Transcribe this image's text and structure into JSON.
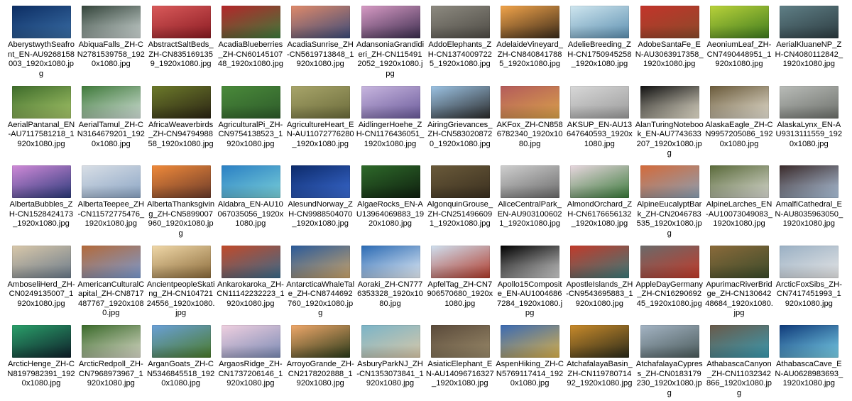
{
  "files": [
    {
      "name": "AberystwythSeafront_EN-AU9268158003_1920x1080.jpg",
      "colors": [
        "#0c2d63",
        "#3a6ea5"
      ]
    },
    {
      "name": "AbiquaFalls_ZH-CN2781539758_1920x1080.jpg",
      "colors": [
        "#33443a",
        "#cfd8d6"
      ]
    },
    {
      "name": "AbstractSaltBeds_ZH-CN8351691359_1920x1080.jpg",
      "colors": [
        "#d95a5a",
        "#8a1b22"
      ]
    },
    {
      "name": "AcadiaBlueberries_ZH-CN6014510748_1920x1080.jpg",
      "colors": [
        "#b5262a",
        "#3d7a3a"
      ]
    },
    {
      "name": "AcadiaSunrise_ZH-CN5619713848_1920x1080.jpg",
      "colors": [
        "#e08a6a",
        "#3b4a78"
      ]
    },
    {
      "name": "AdansoniaGrandidieri_ZH-CN1154912052_1920x1080.jpg",
      "colors": [
        "#d79ac4",
        "#3b2d4e"
      ]
    },
    {
      "name": "AddoElephants_ZH-CN13740097225_1920x1080.jpg",
      "colors": [
        "#8d8a80",
        "#4d4a44"
      ]
    },
    {
      "name": "AdelaideVineyard_ZH-CN8408417885_1920x1080.jpg",
      "colors": [
        "#f2a44a",
        "#3a2a1a"
      ]
    },
    {
      "name": "AdelieBreeding_ZH-CN1750945258_1920x1080.jpg",
      "colors": [
        "#cfe6ef",
        "#5c8fb0"
      ]
    },
    {
      "name": "AdobeSantaFe_EN-AU3063917358_1920x1080.jpg",
      "colors": [
        "#c3342a",
        "#8b4a2a"
      ]
    },
    {
      "name": "AeoniumLeaf_ZH-CN7490448951_1920x1080.jpg",
      "colors": [
        "#b9d23a",
        "#3e7a1e"
      ]
    },
    {
      "name": "AerialKluaneNP_ZH-CN4080112842_1920x1080.jpg",
      "colors": [
        "#5f7f86",
        "#2c3b40"
      ]
    },
    {
      "name": "AerialPantanal_EN-AU7117581218_1920x1080.jpg",
      "colors": [
        "#3d6b2a",
        "#a7c66a"
      ]
    },
    {
      "name": "AerialTamul_ZH-CN3164679201_1920x1080.jpg",
      "colors": [
        "#3f7a3a",
        "#d2e0d9"
      ]
    },
    {
      "name": "AfricaWeaverbirds_ZH-CN9479498858_1920x1080.jpg",
      "colors": [
        "#6c7a2a",
        "#2b2414"
      ]
    },
    {
      "name": "AgriculturalPi_ZH-CN9754138523_1920x1080.jpg",
      "colors": [
        "#4a8a3a",
        "#2d5a2a"
      ]
    },
    {
      "name": "AgricultureHeart_EN-AU11072776280_1920x1080.jpg",
      "colors": [
        "#a8a56a",
        "#6a6a3a"
      ]
    },
    {
      "name": "AidlingerHoehe_ZH-CN1176436051_1920x1080.jpg",
      "colors": [
        "#c8b6df",
        "#6a5a9a"
      ]
    },
    {
      "name": "AiringGrievances_ZH-CN5830208720_1920x1080.jpg",
      "colors": [
        "#9cc3e4",
        "#2a2a2a"
      ]
    },
    {
      "name": "AKFox_ZH-CN8586782340_1920x1080.jpg",
      "colors": [
        "#b45b5b",
        "#d9a24a"
      ]
    },
    {
      "name": "AKSUP_EN-AU13647640593_1920x1080.jpg",
      "colors": [
        "#d8d8d8",
        "#9a9a9a"
      ]
    },
    {
      "name": "AlanTuringNotebook_EN-AU7743633207_1920x1080.jpg",
      "colors": [
        "#111111",
        "#e9e3d0"
      ]
    },
    {
      "name": "AlaskaEagle_ZH-CN9957205086_1920x1080.jpg",
      "colors": [
        "#6a5a3a",
        "#e7e2d4"
      ]
    },
    {
      "name": "AlaskaLynx_EN-AU9313111559_1920x1080.jpg",
      "colors": [
        "#b9bcb8",
        "#6c6f6a"
      ]
    },
    {
      "name": "AlbertaBubbles_ZH-CN1528424173_1920x1080.jpg",
      "colors": [
        "#d08ad8",
        "#2b3a7a"
      ]
    },
    {
      "name": "AlbertaTeepee_ZH-CN11572775476_1920x1080.jpg",
      "colors": [
        "#d9dfe6",
        "#8aa4c4"
      ]
    },
    {
      "name": "AlbertaThanksgiving_ZH-CN5899007960_1920x1080.jpg",
      "colors": [
        "#f08a3a",
        "#6a3a2a"
      ]
    },
    {
      "name": "Aldabra_EN-AU10067035056_1920x1080.jpg",
      "colors": [
        "#2a7fc4",
        "#7ad0d8"
      ]
    },
    {
      "name": "AlesundNorway_ZH-CN9988504070_1920x1080.jpg",
      "colors": [
        "#0c2a6a",
        "#3a6ad0"
      ]
    },
    {
      "name": "AlgaeRocks_EN-AU13964069883_1920x1080.jpg",
      "colors": [
        "#2e6a2a",
        "#0f1f0f"
      ]
    },
    {
      "name": "AlgonquinGrouse_ZH-CN2514966091_1920x1080.jpg",
      "colors": [
        "#6a5a3a",
        "#3a2f1f"
      ]
    },
    {
      "name": "AliceCentralPark_EN-AU9031006021_1920x1080.jpg",
      "colors": [
        "#cfcfcf",
        "#6a6a6a"
      ]
    },
    {
      "name": "AlmondOrchard_ZH-CN6176656132_1920x1080.jpg",
      "colors": [
        "#e8d7df",
        "#3a7a3a"
      ]
    },
    {
      "name": "AlpineEucalyptBark_ZH-CN2046783535_1920x1080.jpg",
      "colors": [
        "#d46a3a",
        "#8aa0b4"
      ]
    },
    {
      "name": "AlpineLarches_EN-AU10073049083_1920x1080.jpg",
      "colors": [
        "#5a6a3a",
        "#d9dad2"
      ]
    },
    {
      "name": "AmalfiCathedral_EN-AU8035963050_1920x1080.jpg",
      "colors": [
        "#3a2a2a",
        "#b0c6df"
      ]
    },
    {
      "name": "AmboseliHerd_ZH-CN0249135007_1920x1080.jpg",
      "colors": [
        "#d9c8aa",
        "#6a7a8a"
      ]
    },
    {
      "name": "AmericanCulturalCapital_ZH-CN8717487767_1920x1080.jpg",
      "colors": [
        "#b46a3a",
        "#7a9ad0"
      ]
    },
    {
      "name": "AncientpeopleSkating_ZH-CN10472124556_1920x1080.jpg",
      "colors": [
        "#f0d8a8",
        "#8a6a3a"
      ]
    },
    {
      "name": "Ankarokaroka_ZH-CN11142232223_1920x1080.jpg",
      "colors": [
        "#c24a2a",
        "#3a6a8a"
      ]
    },
    {
      "name": "AntarcticaWhaleTale_ZH-CN8744692760_1920x1080.jpg",
      "colors": [
        "#2a5a9a",
        "#caa46a"
      ]
    },
    {
      "name": "Aoraki_ZH-CN7776353328_1920x1080.jpg",
      "colors": [
        "#2a6ab4",
        "#e6eef6"
      ]
    },
    {
      "name": "ApfelTag_ZH-CN7906570680_1920x1080.jpg",
      "colors": [
        "#cfe0f0",
        "#b03a2a"
      ]
    },
    {
      "name": "Apollo15Composite_EN-AU10046867284_1920x1080.jpg",
      "colors": [
        "#000000",
        "#cfcfcf"
      ]
    },
    {
      "name": "ApostleIslands_ZH-CN9543695883_1920x1080.jpg",
      "colors": [
        "#c23a2a",
        "#3a7a7a"
      ]
    },
    {
      "name": "AppleDayGermany_ZH-CN1629069245_1920x1080.jpg",
      "colors": [
        "#6a6a6a",
        "#c23a2a"
      ]
    },
    {
      "name": "ApurimacRiverBridge_ZH-CN13064248684_1920x1080.jpg",
      "colors": [
        "#8a6a3a",
        "#3a4a2a"
      ]
    },
    {
      "name": "ArcticFoxSibs_ZH-CN7417451993_1920x1080.jpg",
      "colors": [
        "#9ab0c4",
        "#e6e6e6"
      ]
    },
    {
      "name": "ArcticHenge_ZH-CN8197982391_1920x1080.jpg",
      "colors": [
        "#2aa06a",
        "#0f1f2a"
      ]
    },
    {
      "name": "ArcticRedpoll_ZH-CN7968973967_1920x1080.jpg",
      "colors": [
        "#3a6a2a",
        "#d9d9c8"
      ]
    },
    {
      "name": "ArganGoats_ZH-CN5346845518_1920x1080.jpg",
      "colors": [
        "#6aa0d8",
        "#4a7a2a"
      ]
    },
    {
      "name": "ArgaosRidge_ZH-CN1737206146_1920x1080.jpg",
      "colors": [
        "#f0d0e0",
        "#7a8ab4"
      ]
    },
    {
      "name": "ArroyoGrande_ZH-CN2178202888_1920x1080.jpg",
      "colors": [
        "#f0a86a",
        "#2a3a1a"
      ]
    },
    {
      "name": "AsburyParkNJ_ZH-CN1353073841_1920x1080.jpg",
      "colors": [
        "#7ab4c8",
        "#d9c8a8"
      ]
    },
    {
      "name": "AsiaticElephant_EN-AU14096716327_1920x1080.jpg",
      "colors": [
        "#5a4a3a",
        "#9a8a6a"
      ]
    },
    {
      "name": "AspenHiking_ZH-CN5769117414_1920x1080.jpg",
      "colors": [
        "#3a6ab4",
        "#d8b04a"
      ]
    },
    {
      "name": "AtchafalayaBasin_ZH-CN11978071492_1920x1080.jpg",
      "colors": [
        "#c88a2a",
        "#2a2a1a"
      ]
    },
    {
      "name": "AtchafalayaCypress_ZH-CN0183179230_1920x1080.jpg",
      "colors": [
        "#a4b4c4",
        "#4a5a5a"
      ]
    },
    {
      "name": "AthabascaCanyon_ZH-CN11032342866_1920x1080.jpg",
      "colors": [
        "#6a5a4a",
        "#3a9ab0"
      ]
    },
    {
      "name": "AthabascaCave_EN-AU0628983693_1920x1080.jpg",
      "colors": [
        "#0f3a7a",
        "#7ad0e8"
      ]
    }
  ]
}
